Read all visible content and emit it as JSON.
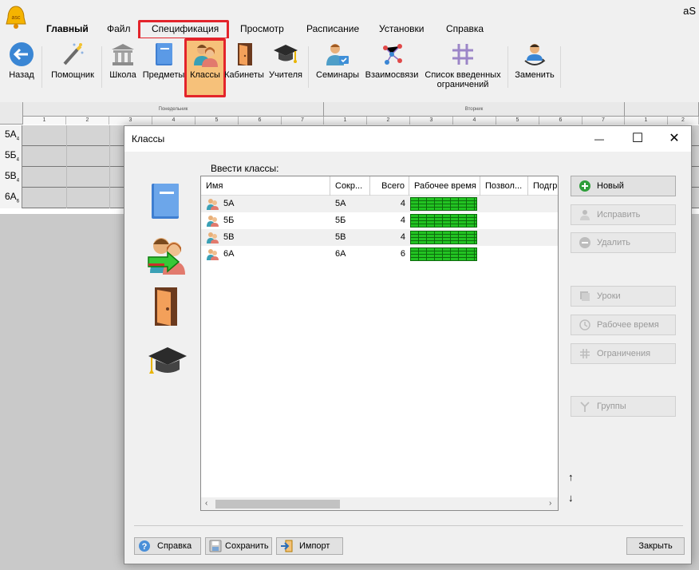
{
  "app": {
    "title": "aS"
  },
  "menu": {
    "items": [
      "Главный",
      "Файл",
      "Спецификация",
      "Просмотр",
      "Расписание",
      "Установки",
      "Справка"
    ]
  },
  "toolbar": {
    "back": "Назад",
    "wizard": "Помощник",
    "school": "Школа",
    "subjects": "Предметы",
    "classes": "Классы",
    "rooms": "Кабинеты",
    "teachers": "Учителя",
    "seminars": "Семинары",
    "relations": "Взаимосвязи",
    "constraints_line1": "Список введенных",
    "constraints_line2": "ограничений",
    "replace": "Заменить"
  },
  "grid": {
    "day1": "Понедельник",
    "day2": "Вторник",
    "periods_day1": [
      "1",
      "2",
      "3",
      "4",
      "5",
      "6",
      "7"
    ],
    "periods_day2": [
      "1",
      "2",
      "3",
      "4",
      "5",
      "6",
      "7"
    ],
    "periods_day3": [
      "1",
      "2"
    ],
    "rows": [
      {
        "name": "5А",
        "sub": "4"
      },
      {
        "name": "5Б",
        "sub": "4"
      },
      {
        "name": "5В",
        "sub": "4"
      },
      {
        "name": "6А",
        "sub": "6"
      }
    ]
  },
  "dialog": {
    "title": "Классы",
    "intro": "Ввести классы:",
    "columns": {
      "name": "Имя",
      "short": "Сокр...",
      "total": "Всего",
      "worktime": "Рабочее время",
      "allowed": "Позвол...",
      "groups": "Подгр"
    },
    "rows": [
      {
        "name": "5А",
        "short": "5А",
        "total": "4"
      },
      {
        "name": "5Б",
        "short": "5Б",
        "total": "4"
      },
      {
        "name": "5В",
        "short": "5В",
        "total": "4"
      },
      {
        "name": "6А",
        "short": "6А",
        "total": "6"
      }
    ],
    "buttons": {
      "new": "Новый",
      "edit": "Исправить",
      "delete": "Удалить",
      "lessons": "Уроки",
      "worktime": "Рабочее время",
      "constraints": "Ограничения",
      "groups": "Группы",
      "help": "Справка",
      "save": "Сохранить",
      "import": "Импорт",
      "close": "Закрыть"
    },
    "move_up": "↑",
    "move_down": "↓",
    "window_controls": {
      "minimize": "—",
      "maximize": "☐",
      "close": "✕"
    }
  },
  "colors": {
    "highlight_red": "#e3242b",
    "worktime_green": "#22c322",
    "accent_orange": "#f6c17a"
  }
}
